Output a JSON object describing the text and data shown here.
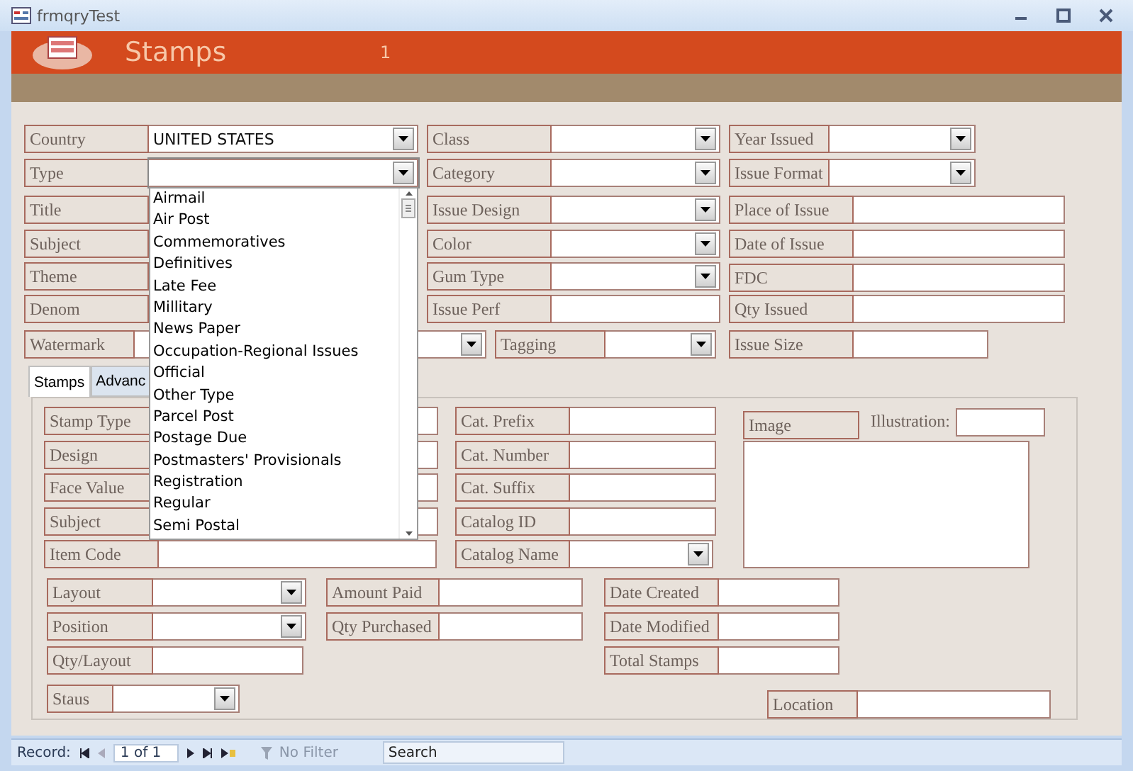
{
  "window": {
    "title": "frmqryTest"
  },
  "header": {
    "title": "Stamps",
    "record_number": "1"
  },
  "top_fields": [
    {
      "label": "Country",
      "kind": "combo",
      "value": "UNITED STATES"
    },
    {
      "label": "Class",
      "kind": "combo"
    },
    {
      "label": "Year Issued",
      "kind": "combo"
    },
    {
      "label": "Type",
      "kind": "combo",
      "focused": true
    },
    {
      "label": "Category",
      "kind": "combo"
    },
    {
      "label": "Issue Format",
      "kind": "combo"
    },
    {
      "label": "Title",
      "kind": "text"
    },
    {
      "label": "Issue Design",
      "kind": "combo"
    },
    {
      "label": "Place of Issue",
      "kind": "text"
    },
    {
      "label": "Subject",
      "kind": "text"
    },
    {
      "label": "Color",
      "kind": "combo"
    },
    {
      "label": "Date of Issue",
      "kind": "text"
    },
    {
      "label": "Theme",
      "kind": "text"
    },
    {
      "label": "Gum Type",
      "kind": "combo"
    },
    {
      "label": "FDC",
      "kind": "text"
    },
    {
      "label": "Denom",
      "kind": "text"
    },
    {
      "label": "Issue Perf",
      "kind": "text"
    },
    {
      "label": "Qty Issued",
      "kind": "text"
    },
    {
      "label": "Watermark",
      "kind": "combo"
    },
    {
      "label": "Tagging",
      "kind": "combo"
    },
    {
      "label": "Issue Size",
      "kind": "text"
    }
  ],
  "tabs": [
    {
      "label": "Stamps",
      "selected": true
    },
    {
      "label": "Advanc",
      "selected": false
    }
  ],
  "tab_fields": [
    {
      "label": "Stamp Type",
      "kind": "text"
    },
    {
      "label": "Design",
      "kind": "text"
    },
    {
      "label": "Face Value",
      "kind": "text"
    },
    {
      "label": "Subject",
      "kind": "text"
    },
    {
      "label": "Item Code",
      "kind": "text"
    },
    {
      "label": "Cat. Prefix",
      "kind": "text"
    },
    {
      "label": "Cat. Number",
      "kind": "text"
    },
    {
      "label": "Cat. Suffix",
      "kind": "text"
    },
    {
      "label": "Catalog ID",
      "kind": "text"
    },
    {
      "label": "Catalog Name",
      "kind": "combo"
    },
    {
      "label": "Image",
      "kind": "image"
    },
    {
      "label": "Illustration:",
      "kind": "bare"
    },
    {
      "label": "Layout",
      "kind": "combo"
    },
    {
      "label": "Position",
      "kind": "combo"
    },
    {
      "label": "Qty/Layout",
      "kind": "text"
    },
    {
      "label": "Staus",
      "kind": "combo"
    },
    {
      "label": "Amount Paid",
      "kind": "text"
    },
    {
      "label": "Qty Purchased",
      "kind": "text"
    },
    {
      "label": "Date Created",
      "kind": "text"
    },
    {
      "label": "Date Modified",
      "kind": "text"
    },
    {
      "label": "Total Stamps",
      "kind": "text"
    },
    {
      "label": "Location",
      "kind": "text"
    }
  ],
  "type_dropdown": {
    "items": [
      "Airmail",
      "Air Post",
      "Commemoratives",
      "Definitives",
      "Late Fee",
      "Millitary",
      "News Paper",
      "Occupation-Regional Issues",
      "Official",
      "Other Type",
      "Parcel Post",
      "Postage Due",
      "Postmasters' Provisionals",
      "Registration",
      "Regular",
      "Semi Postal"
    ]
  },
  "status_bar": {
    "record_label": "Record:",
    "record_position": "1 of 1",
    "filter": "No Filter",
    "search_placeholder": "Search"
  }
}
